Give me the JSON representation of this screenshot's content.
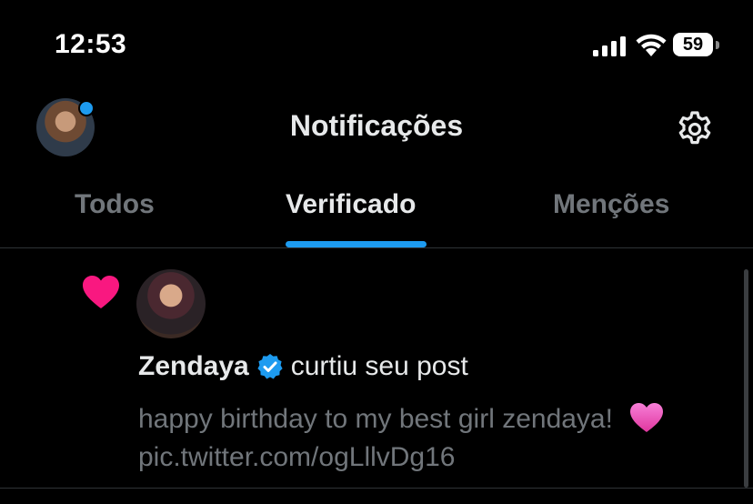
{
  "status_bar": {
    "time": "12:53",
    "battery_level": "59",
    "signal_icon": "cellular-signal-icon",
    "wifi_icon": "wifi-icon",
    "battery_icon": "battery-icon"
  },
  "header": {
    "title": "Notificações",
    "settings_icon": "gear-icon",
    "avatar_badge_color": "#1d9bf0"
  },
  "tabs": [
    {
      "label": "Todos",
      "active": false
    },
    {
      "label": "Verificado",
      "active": true
    },
    {
      "label": "Menções",
      "active": false
    }
  ],
  "colors": {
    "accent": "#1d9bf0",
    "like_heart": "#f91880",
    "background": "#000000",
    "text_primary": "#e7e9ea",
    "text_secondary": "#71767b"
  },
  "notifications": [
    {
      "type_icon": "heart-icon",
      "user_name": "Zendaya",
      "verified_icon": "verified-badge-icon",
      "action": "curtiu seu post",
      "tweet_text": "happy birthday to my best girl zendaya!",
      "tweet_emoji": "pink-heart-emoji",
      "tweet_link": "pic.twitter.com/ogLllvDg16"
    }
  ]
}
